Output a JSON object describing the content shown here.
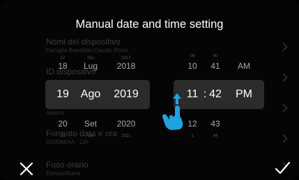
{
  "header": {
    "title": "Manual date and time setting"
  },
  "background_settings": [
    {
      "label": "Nomi del dispositivo",
      "value": "Famiglia Brambilla Claudio Rossi"
    },
    {
      "label": "ID dispositivo",
      "value": ""
    },
    {
      "label": "",
      "value": "Italiano"
    },
    {
      "label": "Formato data e ora",
      "value": "GG/MM/AA - 12h"
    },
    {
      "label": "Fuso orario",
      "value": "Europa/Roma"
    }
  ],
  "date_picker": {
    "tiny_above": {
      "day": "17",
      "month": "Giu",
      "year": "2017"
    },
    "above": {
      "day": "18",
      "month": "Lug",
      "year": "2018"
    },
    "selected": {
      "day": "19",
      "month": "Ago",
      "year": "2019"
    },
    "below": {
      "day": "20",
      "month": "Set",
      "year": "2020"
    },
    "tiny_below": {
      "day": "21",
      "month": "Ott",
      "year": "2021"
    }
  },
  "time_picker": {
    "tiny_above": {
      "hour": "09",
      "minute": "40"
    },
    "above": {
      "hour": "10",
      "minute": "41",
      "ampm": "AM"
    },
    "selected": {
      "hour": "11",
      "separator": ":",
      "minute": "42",
      "ampm": "PM"
    },
    "below": {
      "hour": "12",
      "minute": "43"
    },
    "tiny_below": {
      "hour": "1",
      "minute": "44"
    }
  },
  "icons": {
    "cancel": "close-icon",
    "confirm": "check-icon",
    "gesture": "tap-swipe-hand-icon",
    "list_chevron": "chevron-right-icon"
  },
  "colors": {
    "background": "#050505",
    "selection": "#2b2b2b",
    "hand_accent": "#1fa3de",
    "text": "#ffffff",
    "dim_text": "#a9a9a9"
  }
}
